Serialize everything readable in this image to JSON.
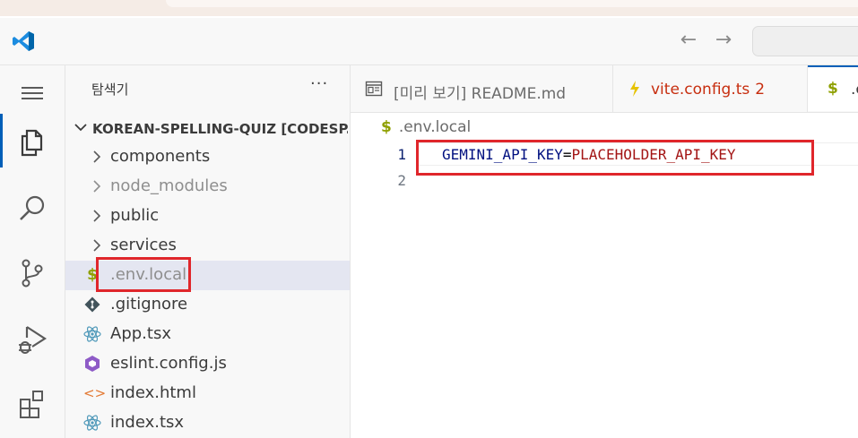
{
  "titlebar": {
    "back_icon": "arrow-left-icon",
    "forward_icon": "arrow-right-icon",
    "command_center_placeholder": ""
  },
  "activity_bar": {
    "items": [
      {
        "name": "menu",
        "icon": "hamburger-icon"
      },
      {
        "name": "explorer",
        "icon": "files-icon",
        "active": true
      },
      {
        "name": "search",
        "icon": "search-icon"
      },
      {
        "name": "source-control",
        "icon": "source-control-icon"
      },
      {
        "name": "run-debug",
        "icon": "run-debug-icon"
      },
      {
        "name": "extensions",
        "icon": "extensions-icon"
      }
    ]
  },
  "sidebar": {
    "title": "탐색기",
    "more": "···",
    "root_label": "KOREAN-SPELLING-QUIZ [CODESP...",
    "items": [
      {
        "label": "components",
        "type": "folder"
      },
      {
        "label": "node_modules",
        "type": "folder",
        "dim": true
      },
      {
        "label": "public",
        "type": "folder"
      },
      {
        "label": "services",
        "type": "folder"
      },
      {
        "label": ".env.local",
        "type": "env",
        "selected": true
      },
      {
        "label": ".gitignore",
        "type": "git"
      },
      {
        "label": "App.tsx",
        "type": "react"
      },
      {
        "label": "eslint.config.js",
        "type": "eslint"
      },
      {
        "label": "index.html",
        "type": "html"
      },
      {
        "label": "index.tsx",
        "type": "react"
      }
    ]
  },
  "editor": {
    "tabs": [
      {
        "label": "[미리 보기] README.md",
        "icon": "preview-icon"
      },
      {
        "label": "vite.config.ts",
        "badge": "2",
        "icon": "vite-icon"
      },
      {
        "label": ".e",
        "icon": "dollar-icon",
        "active": true
      }
    ],
    "breadcrumb": ".env.local",
    "breadcrumb_symbol": "$",
    "lines": [
      {
        "number": "1",
        "key": "GEMINI_API_KEY",
        "eq": "=",
        "value": "PLACEHOLDER_API_KEY"
      },
      {
        "number": "2",
        "key": "",
        "eq": "",
        "value": ""
      }
    ]
  },
  "colors": {
    "accent": "#005fb8",
    "highlight": "#e0262b",
    "env_key": "#001080",
    "env_value": "#a31515",
    "error_badge": "#c72e0f"
  }
}
